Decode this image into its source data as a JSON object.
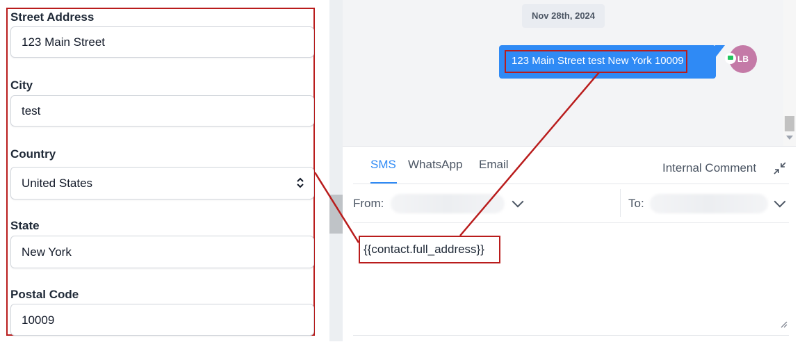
{
  "form": {
    "street_label": "Street Address",
    "street_value": "123 Main Street",
    "city_label": "City",
    "city_value": "test",
    "country_label": "Country",
    "country_value": "United States",
    "state_label": "State",
    "state_value": "New York",
    "postal_label": "Postal Code",
    "postal_value": "10009"
  },
  "chat": {
    "date": "Nov 28th, 2024",
    "message": "123 Main Street test New York 10009",
    "avatar_initials": "LB"
  },
  "composer": {
    "tabs": [
      "SMS",
      "WhatsApp",
      "Email"
    ],
    "active_tab": "SMS",
    "internal_comment": "Internal Comment",
    "from_label": "From:",
    "to_label": "To:",
    "body": "{{contact.full_address}}"
  },
  "colors": {
    "accent": "#2f8af5",
    "highlight": "#b91c1c",
    "avatar": "#c47aa7"
  }
}
